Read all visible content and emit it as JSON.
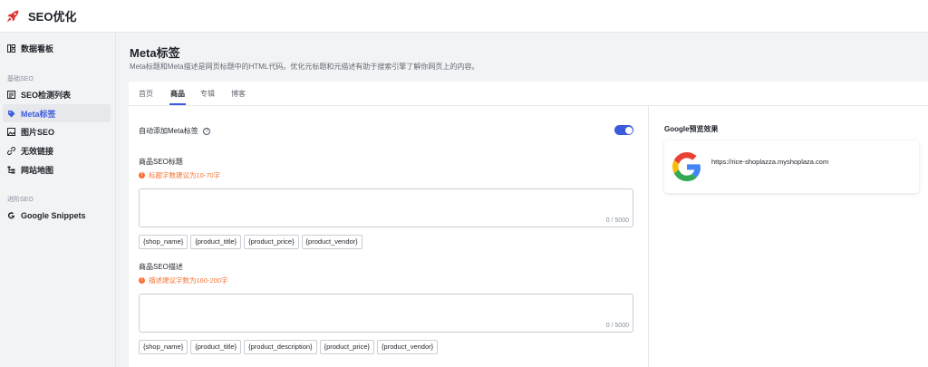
{
  "header": {
    "app_title": "SEO优化",
    "logo_icon": "rocket-icon",
    "accent": "#e03131"
  },
  "sidebar": {
    "items": [
      {
        "label": "数据看板",
        "icon": "dashboard-icon"
      },
      {
        "label": "SEO检测列表",
        "icon": "list-icon"
      },
      {
        "label": "Meta标签",
        "icon": "tag-icon",
        "active": true
      },
      {
        "label": "图片SEO",
        "icon": "image-icon"
      },
      {
        "label": "无效链接",
        "icon": "link-icon"
      },
      {
        "label": "网站地图",
        "icon": "sitemap-icon"
      },
      {
        "label": "Google Snippets",
        "icon": "google-icon"
      }
    ],
    "groups": {
      "basic": "基础SEO",
      "advanced": "进阶SEO"
    }
  },
  "main": {
    "title": "Meta标签",
    "description": "Meta标题和Meta描述是网页标题中的HTML代码。优化元标题和元描述有助于搜索引擎了解你网页上的内容。",
    "tabs": [
      {
        "label": "首页"
      },
      {
        "label": "商品",
        "active": true
      },
      {
        "label": "专辑"
      },
      {
        "label": "博客"
      }
    ],
    "auto_add": {
      "label": "自动添加Meta标签",
      "enabled": true
    },
    "seo_title": {
      "label": "商品SEO标题",
      "hint": "标题字数建议为10-70字",
      "value": "",
      "counter": "0 / 5000",
      "tags": [
        "{shop_name}",
        "{product_title}",
        "{product_price}",
        "{product_vendor}"
      ]
    },
    "seo_desc": {
      "label": "商品SEO描述",
      "hint": "描述建议字数为160-200字",
      "value": "",
      "counter": "0 / 5000",
      "tags": [
        "{shop_name}",
        "{product_title}",
        "{product_description}",
        "{product_price}",
        "{product_vendor}"
      ]
    },
    "preview": {
      "title": "Google预览效果",
      "url": "https://rice-shoplazza.myshoplaza.com"
    }
  },
  "colors": {
    "accent": "#3b5bdb",
    "warning": "#f77234"
  }
}
